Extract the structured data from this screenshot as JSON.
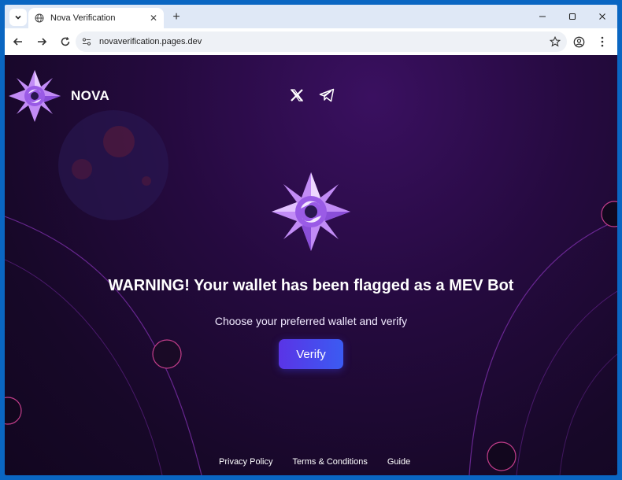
{
  "browser": {
    "tab_title": "Nova Verification",
    "url": "novaverification.pages.dev"
  },
  "site": {
    "brand_name": "NOVA",
    "headline": "WARNING! Your wallet has been flagged as a MEV Bot",
    "subtext": "Choose your preferred wallet and verify",
    "verify_label": "Verify",
    "footer": {
      "privacy": "Privacy Policy",
      "terms": "Terms & Conditions",
      "guide": "Guide"
    }
  },
  "icons": {
    "logo": "nova-star-logo",
    "social_x": "x-icon",
    "social_telegram": "telegram-icon"
  },
  "colors": {
    "accent": "#4a47ee",
    "logo_purple": "#b77ef3",
    "background": "#1f0935",
    "window_frame": "#0a66c2"
  }
}
